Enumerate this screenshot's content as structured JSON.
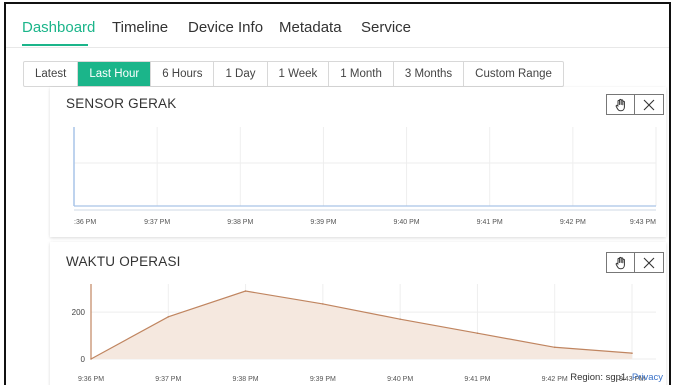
{
  "tabs": [
    "Dashboard",
    "Timeline",
    "Device Info",
    "Metadata",
    "Service"
  ],
  "active_tab": "Dashboard",
  "ranges": [
    "Latest",
    "Last Hour",
    "6 Hours",
    "1 Day",
    "1 Week",
    "1 Month",
    "3 Months",
    "Custom Range"
  ],
  "active_range": "Last Hour",
  "cards": {
    "sensor": {
      "title": "SENSOR GERAK"
    },
    "waktu": {
      "title": "WAKTU OPERASI"
    }
  },
  "icons": {
    "pan": "hand-icon",
    "close": "close-icon"
  },
  "colors": {
    "accent": "#1bb58a",
    "sensor_line": "#a9c4e8",
    "waktu_line": "#c08560",
    "waktu_fill": "#f5e8df"
  },
  "footer": {
    "region": "Region: sgp1",
    "privacy": "Privacy"
  },
  "chart_data": [
    {
      "type": "line",
      "title": "SENSOR GERAK",
      "x": [
        "9:36 PM",
        "9:37 PM",
        "9:38 PM",
        "9:39 PM",
        "9:40 PM",
        "9:41 PM",
        "9:42 PM",
        "9:43 PM"
      ],
      "x_tick_labels": [
        ":36 PM",
        "9:37 PM",
        "9:38 PM",
        "9:39 PM",
        "9:40 PM",
        "9:41 PM",
        "9:42 PM",
        "9:43 PM"
      ],
      "series": [
        {
          "values": [
            0,
            0,
            0,
            0,
            0,
            0,
            0,
            0
          ]
        }
      ],
      "grid": true
    },
    {
      "type": "area",
      "title": "WAKTU OPERASI",
      "x": [
        "9:36 PM",
        "9:37 PM",
        "9:38 PM",
        "9:39 PM",
        "9:40 PM",
        "9:41 PM",
        "9:42 PM",
        "9:43 PM"
      ],
      "y_tick_labels": [
        "0",
        "200"
      ],
      "ylim": [
        0,
        320
      ],
      "series": [
        {
          "x": [
            0,
            1,
            2,
            3,
            4,
            5,
            6,
            7
          ],
          "values": [
            0,
            180,
            290,
            235,
            170,
            110,
            50,
            25
          ]
        }
      ],
      "grid": true
    }
  ]
}
